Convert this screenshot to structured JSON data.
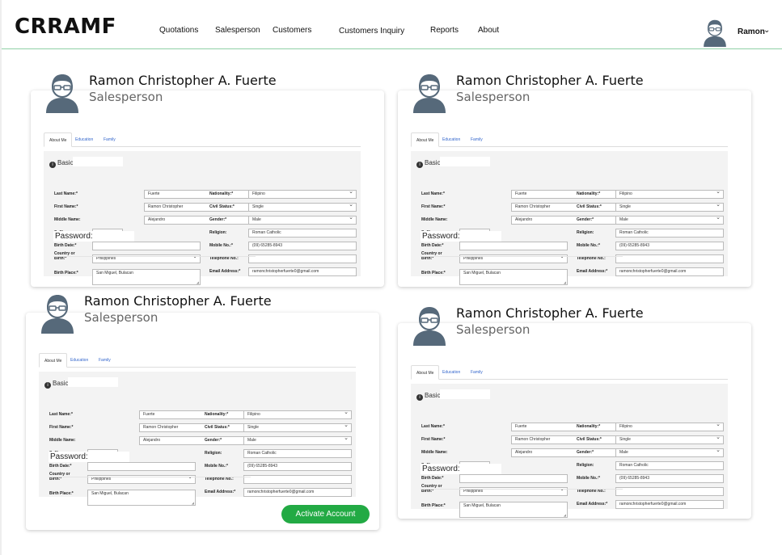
{
  "brand": "CRRAMF",
  "nav": {
    "links": [
      "Quotations",
      "Salesperson",
      "Customers",
      "Customers Inquiry",
      "Reports",
      "About"
    ],
    "user_name": "Ramon"
  },
  "profile": {
    "name": "Ramon Christopher A. Fuerte",
    "role": "Salesperson"
  },
  "tabs": [
    "About Me",
    "Education",
    "Family"
  ],
  "section_title": "Basic Information",
  "password_label": "Password:",
  "labels": {
    "last_name": "Last Name:*",
    "first_name": "First Name:*",
    "middle_name": "Middle Name:",
    "suffix": "Suffix:",
    "birth_date": "Birth Date:*",
    "country_of_birth": "Country or Birth:*",
    "birth_place": "Birth Place:*",
    "nationality": "Nationality:*",
    "civil_status": "Civil Status:*",
    "gender": "Gender:*",
    "religion": "Religion:",
    "mobile_no": "Mobile No.:*",
    "telephone_no": "Telephone No.:",
    "email": "Email Address:*"
  },
  "values": {
    "last_name": "Fuerte",
    "first_name": "Ramon Christopher",
    "middle_name": "Alejandro",
    "suffix": "",
    "birth_date": "",
    "country_of_birth": "Philippines",
    "birth_place": "San Miguel, Bulacan",
    "nationality": "Filipino",
    "civil_status": "Single",
    "gender": "Male",
    "religion": "Roman Catholic",
    "mobile_no": "(09) 65285-8943",
    "telephone_no": "",
    "email": "ramonchristopherfuerte0@gmail.com"
  },
  "activate_button": "Activate Account",
  "colors": {
    "accent_line": "#8fd1a5",
    "activate_green": "#22aa44",
    "avatar": "#56697a",
    "tab_link": "#3366cc"
  }
}
